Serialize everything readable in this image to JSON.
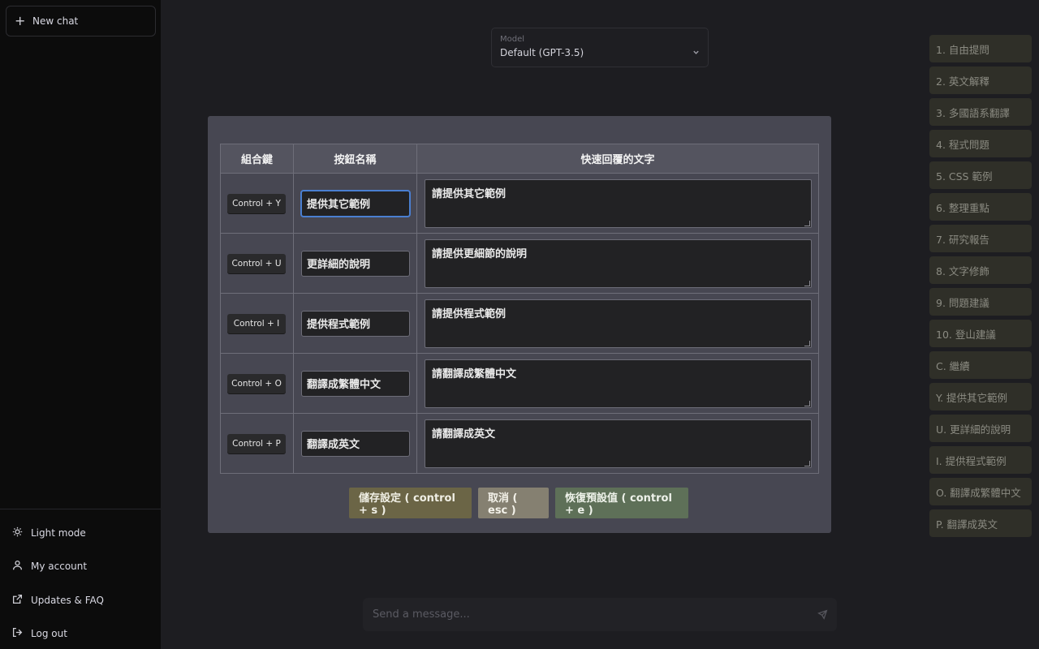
{
  "sidebar": {
    "new_chat": "New chat",
    "bottom_items": [
      {
        "label": "Light mode",
        "icon": "sun-icon"
      },
      {
        "label": "My account",
        "icon": "user-icon"
      },
      {
        "label": "Updates & FAQ",
        "icon": "external-link-icon"
      },
      {
        "label": "Log out",
        "icon": "logout-icon"
      }
    ]
  },
  "model": {
    "label": "Model",
    "value": "Default (GPT-3.5)"
  },
  "modal": {
    "headers": [
      "組合鍵",
      "按鈕名稱",
      "快速回覆的文字"
    ],
    "rows": [
      {
        "key": "Control + Y",
        "name": "提供其它範例",
        "reply": "請提供其它範例"
      },
      {
        "key": "Control + U",
        "name": "更詳細的說明",
        "reply": "請提供更細節的說明"
      },
      {
        "key": "Control + I",
        "name": "提供程式範例",
        "reply": "請提供程式範例"
      },
      {
        "key": "Control + O",
        "name": "翻譯成繁體中文",
        "reply": "請翻譯成繁體中文"
      },
      {
        "key": "Control + P",
        "name": "翻譯成英文",
        "reply": "請翻譯成英文"
      }
    ],
    "buttons": {
      "save": "儲存設定 ( control + s )",
      "cancel": "取消 ( esc )",
      "reset": "恢復預設值 ( control + e )"
    }
  },
  "prompts": [
    "1. 自由提問",
    "2. 英文解釋",
    "3. 多國語系翻譯",
    "4. 程式問題",
    "5. CSS 範例",
    "6. 整理重點",
    "7. 研究報告",
    "8. 文字修飾",
    "9. 問題建議",
    "10. 登山建議",
    "C. 繼續",
    "Y. 提供其它範例",
    "U. 更詳細的說明",
    "I. 提供程式範例",
    "O. 翻譯成繁體中文",
    "P. 翻譯成英文"
  ],
  "composer": {
    "placeholder": "Send a message..."
  }
}
